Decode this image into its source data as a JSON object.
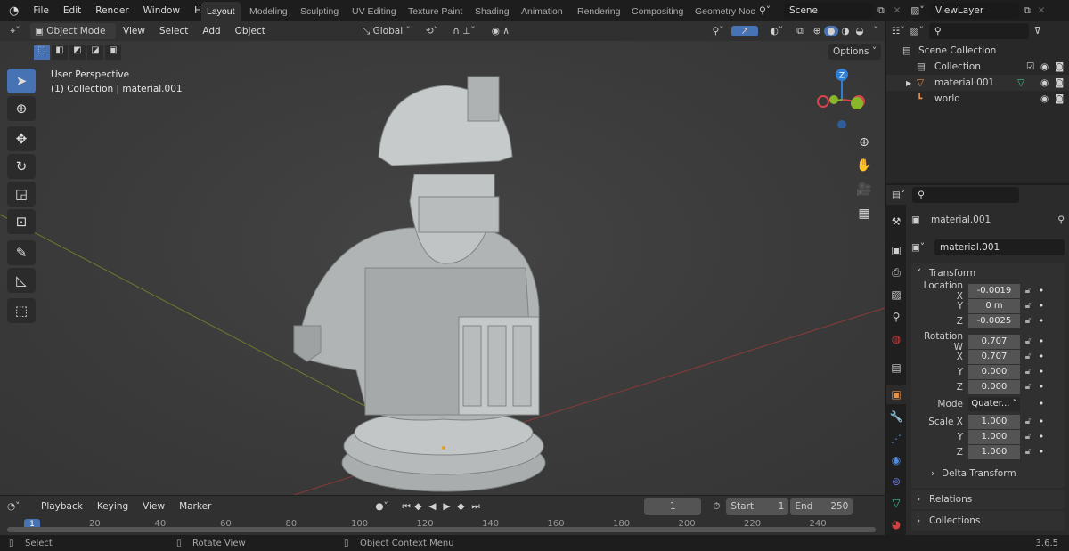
{
  "topbar": {
    "logo": "blender-logo",
    "menus": [
      "File",
      "Edit",
      "Render",
      "Window",
      "Help"
    ],
    "workspaces": [
      "Layout",
      "Modeling",
      "Sculpting",
      "UV Editing",
      "Texture Paint",
      "Shading",
      "Animation",
      "Rendering",
      "Compositing",
      "Geometry Noc"
    ],
    "active_workspace": "Layout",
    "scene": "Scene",
    "view_layer": "ViewLayer"
  },
  "viewport_header": {
    "mode": "Object Mode",
    "menus": [
      "View",
      "Select",
      "Add",
      "Object"
    ],
    "orientation": "Global",
    "options": "Options"
  },
  "viewport": {
    "perspective": "User Perspective",
    "collection_info": "(1) Collection | material.001",
    "gizmo_axes": {
      "z": "Z",
      "x": "X",
      "y": "Y"
    },
    "axis_colors": {
      "x": "#d9434e",
      "y": "#8ab62a",
      "z": "#2f7fd6"
    }
  },
  "outliner": {
    "items": [
      {
        "label": "Scene Collection",
        "icon": "scene-collection-icon"
      },
      {
        "label": "Collection",
        "icon": "collection-icon"
      },
      {
        "label": "material.001",
        "icon": "mesh-icon"
      },
      {
        "label": "world",
        "icon": "empty-icon"
      }
    ]
  },
  "properties": {
    "object_name": "material.001",
    "datablock": "material.001",
    "transform": {
      "title": "Transform",
      "location": {
        "label": "Location X",
        "x": "-0.0019",
        "y": "0 m",
        "z": "-0.0025"
      },
      "rotation": {
        "label": "Rotation W",
        "w": "0.707",
        "x": "0.707",
        "y": "0.000",
        "z": "0.000"
      },
      "mode_label": "Mode",
      "mode": "Quater...",
      "scale": {
        "label": "Scale X",
        "x": "1.000",
        "y": "1.000",
        "z": "1.000"
      },
      "axis": {
        "x": "X",
        "y": "Y",
        "z": "Z"
      }
    },
    "delta_transform": "Delta Transform",
    "relations": "Relations",
    "collections": "Collections"
  },
  "timeline": {
    "menus": [
      "Playback",
      "Keying",
      "View",
      "Marker"
    ],
    "current_frame": "1",
    "start_label": "Start",
    "start": "1",
    "end_label": "End",
    "end": "250",
    "ticks": [
      "20",
      "40",
      "60",
      "80",
      "100",
      "120",
      "140",
      "160",
      "180",
      "200",
      "220",
      "240"
    ],
    "playhead": "1"
  },
  "status": {
    "select": "Select",
    "rotate": "Rotate View",
    "context": "Object Context Menu",
    "version": "3.6.5"
  },
  "colors": {
    "accent": "#4772b3",
    "background": "#3d3d3d"
  }
}
